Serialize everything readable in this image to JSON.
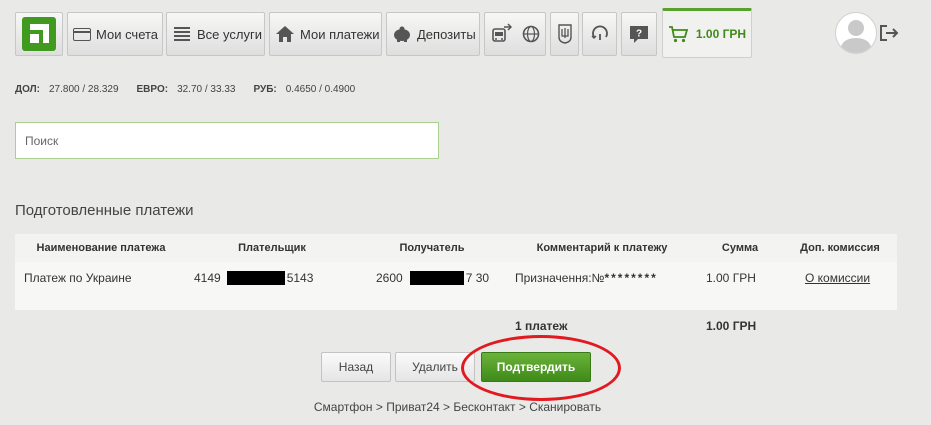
{
  "nav": {
    "tabs": {
      "accounts": "Мои счета",
      "services": "Все услуги",
      "payments": "Мои платежи",
      "deposits": "Депозиты"
    },
    "cart_amount": "1.00 ГРН",
    "icons": [
      "privatbank-logo-icon",
      "card-icon",
      "list-icon",
      "home-icon",
      "piggy-bank-icon",
      "transport-icon",
      "globe-icon",
      "trident-emblem-icon",
      "dial-icon",
      "help-icon",
      "cart-icon",
      "avatar-icon",
      "exit-icon"
    ],
    "brand_color": "#5aa02c"
  },
  "rates": [
    {
      "label": "ДОЛ:",
      "value": "27.800 / 28.329"
    },
    {
      "label": "ЕВРО:",
      "value": "32.70 / 33.33"
    },
    {
      "label": "РУБ:",
      "value": "0.4650 / 0.4900"
    }
  ],
  "search": {
    "placeholder": "Поиск"
  },
  "prepared": {
    "title": "Подготовленные платежи",
    "columns": {
      "name": "Наименование платежа",
      "payer": "Плательщик",
      "recipient": "Получатель",
      "comment": "Комментарий к платежу",
      "sum": "Сумма",
      "commission": "Доп. комиссия"
    },
    "rows": [
      {
        "name": "Платеж по Украине",
        "payer_start": "4149",
        "payer_end": "5143",
        "recipient_start": "2600",
        "recipient_end": "7 30",
        "comment": "Призначення:№",
        "comment_mask": "********",
        "sum": "1.00 ГРН",
        "commission": "О комиссии"
      }
    ],
    "totals": {
      "count": "1 платеж",
      "sum": "1.00 ГРН"
    }
  },
  "buttons": {
    "back": "Назад",
    "delete": "Удалить",
    "confirm": "Подтвердить"
  },
  "footer_path": "Смартфон > Приват24 > Бесконтакт > Сканировать",
  "colors": {
    "confirm_button": "#4f9a24",
    "highlight_circle": "#e11a22"
  }
}
